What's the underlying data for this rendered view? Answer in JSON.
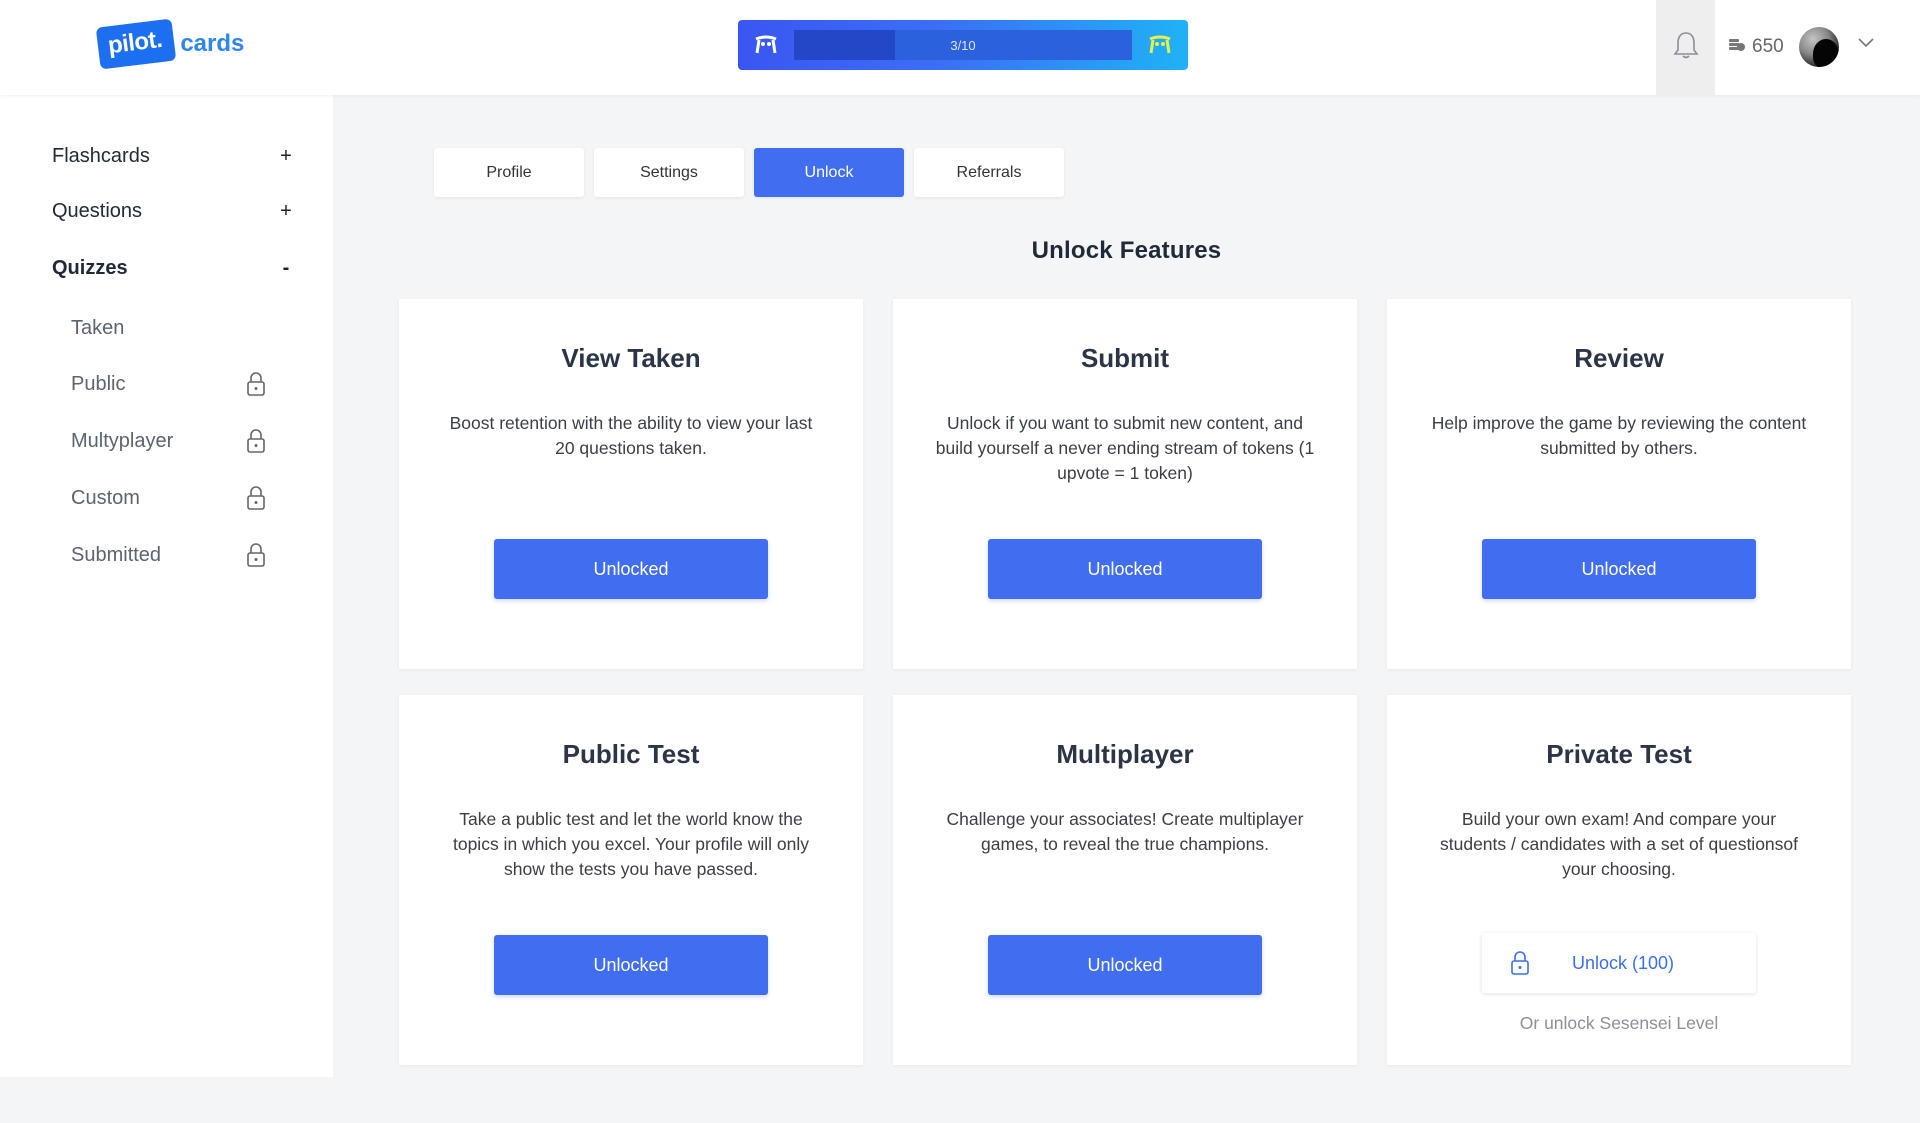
{
  "header": {
    "logo_badge": "pilot.",
    "logo_text": "cards",
    "progress_text": "3/10",
    "progress": 0.3,
    "tokens": "650"
  },
  "sidebar": {
    "sections": [
      {
        "label": "Flashcards",
        "sign": "+"
      },
      {
        "label": "Questions",
        "sign": "+"
      },
      {
        "label": "Quizzes",
        "sign": "-"
      }
    ],
    "quizzes": [
      {
        "label": "Taken",
        "locked": false
      },
      {
        "label": "Public",
        "locked": true
      },
      {
        "label": "Multyplayer",
        "locked": true
      },
      {
        "label": "Custom",
        "locked": true
      },
      {
        "label": "Submitted",
        "locked": true
      }
    ]
  },
  "tabs": [
    {
      "label": "Profile",
      "active": false
    },
    {
      "label": "Settings",
      "active": false
    },
    {
      "label": "Unlock",
      "active": true
    },
    {
      "label": "Referrals",
      "active": false
    }
  ],
  "main": {
    "title": "Unlock Features",
    "cards": [
      {
        "title": "View Taken",
        "desc": "Boost retention with the ability to view your last 20 questions taken.",
        "button": "Unlocked"
      },
      {
        "title": "Submit",
        "desc": "Unlock if you want to submit new content, and build yourself a never ending stream of tokens (1 upvote = 1 token)",
        "button": "Unlocked"
      },
      {
        "title": "Review",
        "desc": "Help improve the game by reviewing the content submitted by others.",
        "button": "Unlocked"
      },
      {
        "title": "Public Test",
        "desc": "Take a public test and let the world know the topics in which you excel. Your profile will only show the tests you have passed.",
        "button": "Unlocked"
      },
      {
        "title": "Multiplayer",
        "desc": "Challenge your associates! Create multiplayer games, to reveal the true champions.",
        "button": "Unlocked"
      },
      {
        "title": "Private Test",
        "desc": "Build your own exam! And compare your students / candidates with a set of questionsof your choosing.",
        "button": "Unlock (100)",
        "alt": "Or unlock Sesensei Level"
      }
    ]
  },
  "colors": {
    "accent": "#416ef0",
    "logo_blue": "#1d6ff2",
    "background": "#f4f5f7"
  },
  "icons": {
    "mascot_left": "mascot-icon",
    "mascot_right": "mascot-icon",
    "bell": "bell-icon",
    "tokens": "coins-icon",
    "chevron": "chevron-down-icon",
    "lock": "lock-icon"
  }
}
